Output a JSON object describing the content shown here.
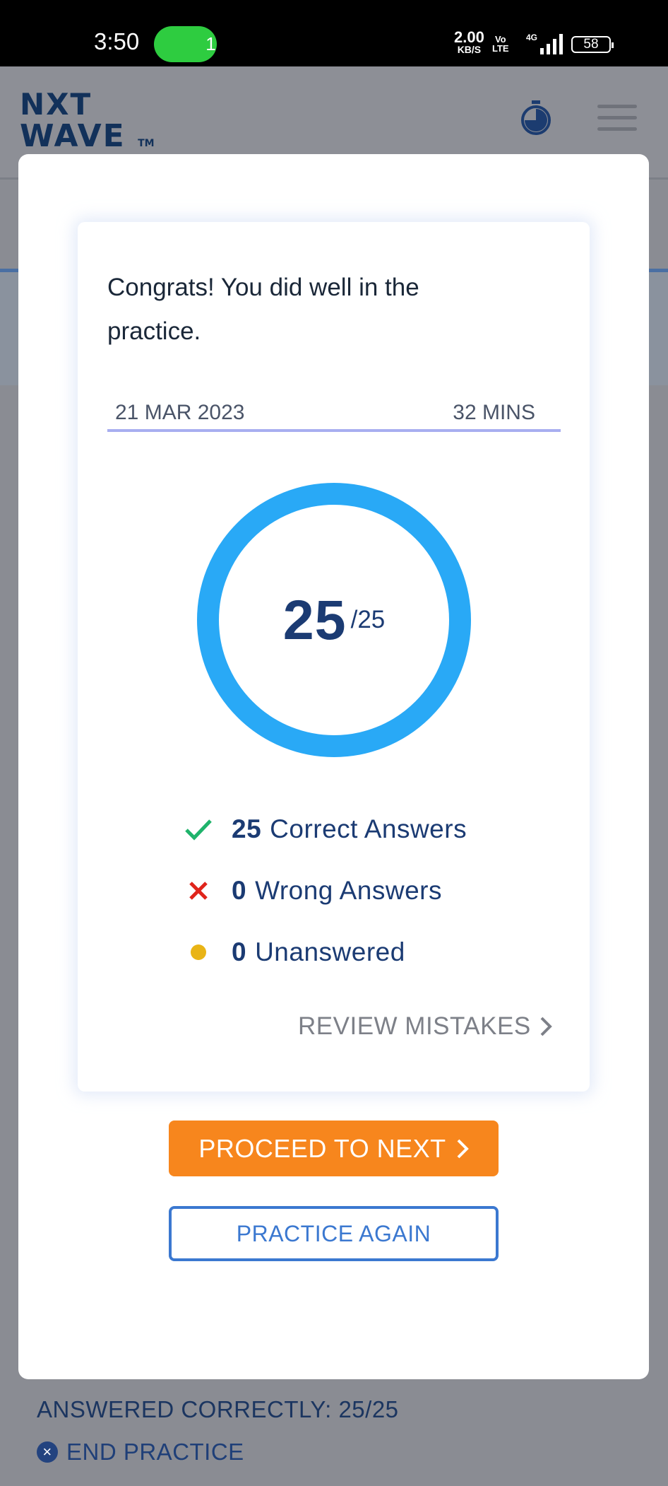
{
  "status_bar": {
    "time": "3:50",
    "hotspot_count": "1",
    "data_rate": "2.00",
    "data_rate_unit": "KB/S",
    "volte": [
      "Vo",
      "LTE"
    ],
    "network": "4G",
    "battery": "58",
    "hotspot_color": "#2ecc40"
  },
  "header": {
    "logo_line1": "NXT",
    "logo_line2": "WAVE",
    "logo_tm": "TM",
    "icons": [
      "stopwatch-icon",
      "hamburger-menu-icon"
    ]
  },
  "modal": {
    "message": "Congrats! You did well in the practice.",
    "date": "21 MAR 2023",
    "duration": "32 MINS",
    "score": {
      "obtained": "25",
      "total": "/25",
      "progress_fraction": 1.0,
      "ring_color": "#29a9f6"
    },
    "stats": [
      {
        "icon": "check-icon",
        "color": "#1fb36b",
        "count": "25",
        "label": "Correct Answers"
      },
      {
        "icon": "cross-icon",
        "color": "#e0241b",
        "count": "0",
        "label": "Wrong Answers"
      },
      {
        "icon": "dot-icon",
        "color": "#e9b416",
        "count": "0",
        "label": "Unanswered"
      }
    ],
    "review_label": "REVIEW MISTAKES",
    "proceed_label": "PROCEED TO NEXT",
    "practice_again_label": "PRACTICE AGAIN",
    "accent_orange": "#f7861d",
    "accent_blue": "#3b78d0"
  },
  "footer": {
    "answered_text": "ANSWERED CORRECTLY: 25/25",
    "end_label": "END PRACTICE"
  }
}
